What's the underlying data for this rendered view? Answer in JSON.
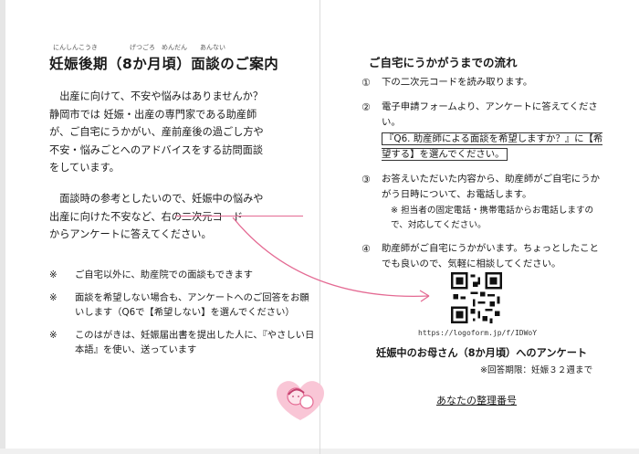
{
  "left": {
    "title": "妊娠後期（8か月頃）面談のご案内",
    "title_ruby": "にんしんこうき　　　　　げつごろ　めんだん　　あんない",
    "intro": "　出産に向けて、不安や悩みはありませんか？\n静岡市では 妊娠・出産の専門家である助産師\nが、ご自宅にうかがい、産前産後の過ごし方や\n不安・悩みごとへのアドバイスをする訪問面談\nをしています。",
    "qr_note": "　面談時の参考としたいので、妊娠中の悩みや\n出産に向けた不安など、右の二次元コード\nからアンケートに答えてください。",
    "notes": [
      "ご自宅以外に、助産院での面談もできます",
      "面談を希望しない場合も、アンケートへのご回答をお願いします（Q6で【希望しない】を選んでください）",
      "このはがきは、妊娠届出書を提出した人に、『やさしい日本語』を使い、送っています"
    ],
    "note_mark": "※"
  },
  "right": {
    "heading": "ご自宅にうかがうまでの流れ",
    "steps": [
      {
        "num": "①",
        "text": "下の二次元コードを読み取ります。"
      },
      {
        "num": "②",
        "text": "電子申請フォームより、アンケートに答えてください。",
        "boxed": "『Q6. 助産師による面談を希望しますか？』に【希望する】を選んでください。"
      },
      {
        "num": "③",
        "text": "お答えいただいた内容から、助産師がご自宅にうかがう日時について、お電話します。",
        "sub": "※ 担当者の固定電話・携帯電話からお電話しますので、対応してください。"
      },
      {
        "num": "④",
        "text": "助産師がご自宅にうかがいます。ちょっとしたことでも良いので、気軽に相談してください。"
      }
    ],
    "qr_url": "https://logoform.jp/f/IDWoY",
    "survey_title": "妊娠中のお母さん（8か月頃）へのアンケート",
    "deadline": "※回答期限：妊娠３２週まで",
    "ref_number_label": "あなたの整理番号"
  },
  "colors": {
    "accent_pink": "#e46a93",
    "logo_pink": "#f4a7c0"
  },
  "icons": {
    "logo": "mother-baby-logo-icon",
    "qr": "qr-code-icon"
  }
}
